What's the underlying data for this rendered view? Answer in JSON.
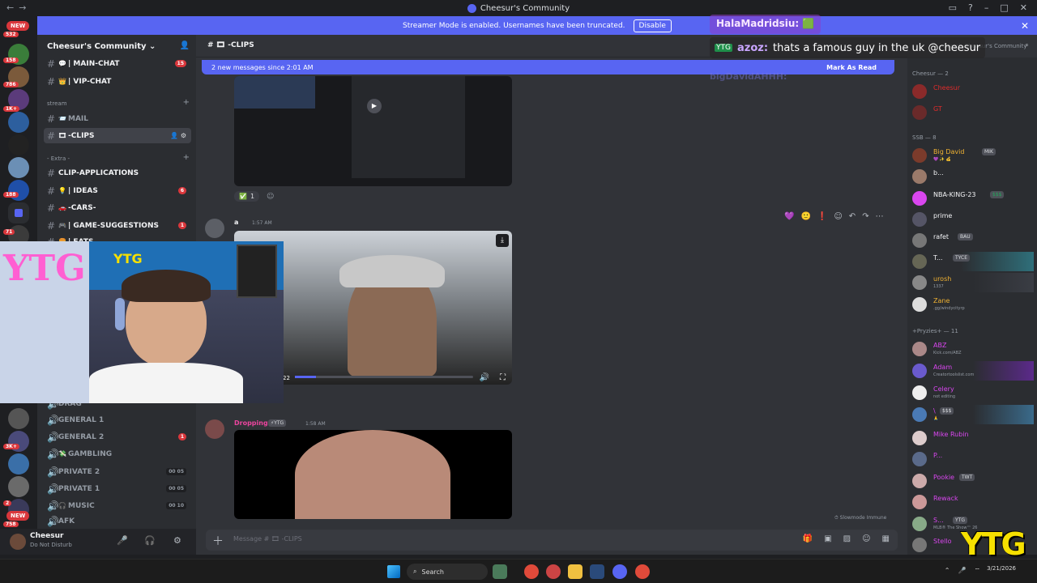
{
  "window": {
    "title": "Cheesur's Community",
    "controls": [
      "–",
      "□",
      "✕"
    ]
  },
  "banner": {
    "text": "Streamer Mode is enabled. Usernames have been truncated.",
    "button": "Disable"
  },
  "rail": {
    "new_top": "NEW",
    "new_bottom": "NEW",
    "badges": [
      "532",
      "158",
      "786",
      "1K+",
      "1",
      "7",
      "188",
      "71",
      "3K+",
      "2",
      "758"
    ]
  },
  "server": {
    "name": "Cheesur's Community"
  },
  "channels": {
    "main_chat": "| MAIN-CHAT",
    "main_chat_badge": "15",
    "vip_chat": "| VIP-CHAT",
    "cat_stream": "stream",
    "mail": "MAIL",
    "clips": "-CLIPS",
    "cat_extra": "- Extra -",
    "clip_applications": "CLIP-APPLICATIONS",
    "ideas": "| IDEAS",
    "ideas_badge": "6",
    "cars": "-CARS-",
    "game_suggestions": "| GAME-SUGGESTIONS",
    "game_badge": "1",
    "eats": "| EATS",
    "drag": "DRAG",
    "general1": "GENERAL 1",
    "general2": "GENERAL 2",
    "general2_badge": "1",
    "gambling": "GAMBLING",
    "private2": "PRIVATE 2",
    "private2_count": "00",
    "private2_limit": "05",
    "private1": "PRIVATE 1",
    "private1_count": "00",
    "private1_limit": "05",
    "music": "MUSIC",
    "music_count": "00",
    "music_limit": "10",
    "afk": "AFK"
  },
  "user": {
    "name": "Cheesur",
    "status": "Do Not Disturb"
  },
  "chat": {
    "channel_title": "-CLIPS",
    "new_messages": "2 new messages since 2:01 AM",
    "mark_as_read": "Mark As Read",
    "reaction_count": "1",
    "msg1_time": "1:57 AM",
    "msg1_author": "a",
    "video_time": "22",
    "msg2_author": "Dropping",
    "msg2_tag": "YTG",
    "msg2_time": "1:58 AM",
    "slowmode": "Slowmode Immune",
    "composer_placeholder": "Message #",
    "composer_channel": "-CLIPS"
  },
  "members": {
    "search": "Search Cheesur's Community",
    "groups": [
      {
        "label": "Cheesur — 2"
      },
      {
        "label": "SSB — 8"
      },
      {
        "label": "+Pryzies+ — 11"
      }
    ],
    "owners": [
      {
        "name": "Cheesur",
        "color": "#e02b2b"
      },
      {
        "name": "GT",
        "color": "#e02b2b"
      }
    ],
    "ssb": [
      {
        "name": "Big David",
        "tag": "MIK",
        "color": "#f0b232",
        "status": "💜 ✨ 💰"
      },
      {
        "name": "b...",
        "tag": "",
        "color": "#f2f3f5",
        "status": ""
      },
      {
        "name": "NBA-KING-23",
        "tag": "$$$",
        "color": "#f2f3f5",
        "status": ""
      },
      {
        "name": "prime",
        "tag": "",
        "color": "#f2f3f5",
        "status": ""
      },
      {
        "name": "rafet",
        "tag": "BAU",
        "color": "#f2f3f5",
        "status": ""
      },
      {
        "name": "T...",
        "tag": "TYCE",
        "color": "#f2f3f5",
        "status": ""
      },
      {
        "name": "urosh",
        "tag": "",
        "color": "#f2f3f5",
        "status": "1337"
      },
      {
        "name": "Zane",
        "tag": "",
        "color": "#f2f3f5",
        "status": ".gg/windycityrp"
      }
    ],
    "pryzies": [
      {
        "name": "ABZ",
        "tag": "",
        "color": "#d946ef",
        "status": "Kick.com/ABZ"
      },
      {
        "name": "Adam",
        "tag": "",
        "color": "#d946ef",
        "status": "Creatortoolslist.com"
      },
      {
        "name": "Celery",
        "tag": "",
        "color": "#d946ef",
        "status": "not editing"
      },
      {
        "name": "\\",
        "tag": "$$$",
        "color": "#d946ef",
        "status": "🙏"
      },
      {
        "name": "Mike Rubin",
        "tag": "",
        "color": "#d946ef",
        "status": ""
      },
      {
        "name": "P...",
        "tag": "",
        "color": "#d946ef",
        "status": ""
      },
      {
        "name": "Pookie",
        "tag": "TWT",
        "color": "#d946ef",
        "status": ""
      },
      {
        "name": "Rewack",
        "tag": "",
        "color": "#d946ef",
        "status": ""
      },
      {
        "name": "S...",
        "tag": "YTG",
        "color": "#d946ef",
        "status": "MLB® The Show™ 26"
      },
      {
        "name": "Stello",
        "tag": "",
        "color": "#d946ef",
        "status": ""
      }
    ]
  },
  "overlay": {
    "line1": "HalaMadridsiu:",
    "line2_user": "azoz:",
    "line2_msg": "thats a famous guy in the uk @cheesur",
    "ghost_name": "bigDavidAHHH:",
    "logo": "YTG",
    "webcam_sign": "YTG"
  },
  "taskbar": {
    "search": "Search",
    "time": "",
    "date": "3/21/2026"
  },
  "colors": {
    "blurple": "#5865f2",
    "dnd_red": "#da373c",
    "overlay_yellow": "#f6e000"
  }
}
